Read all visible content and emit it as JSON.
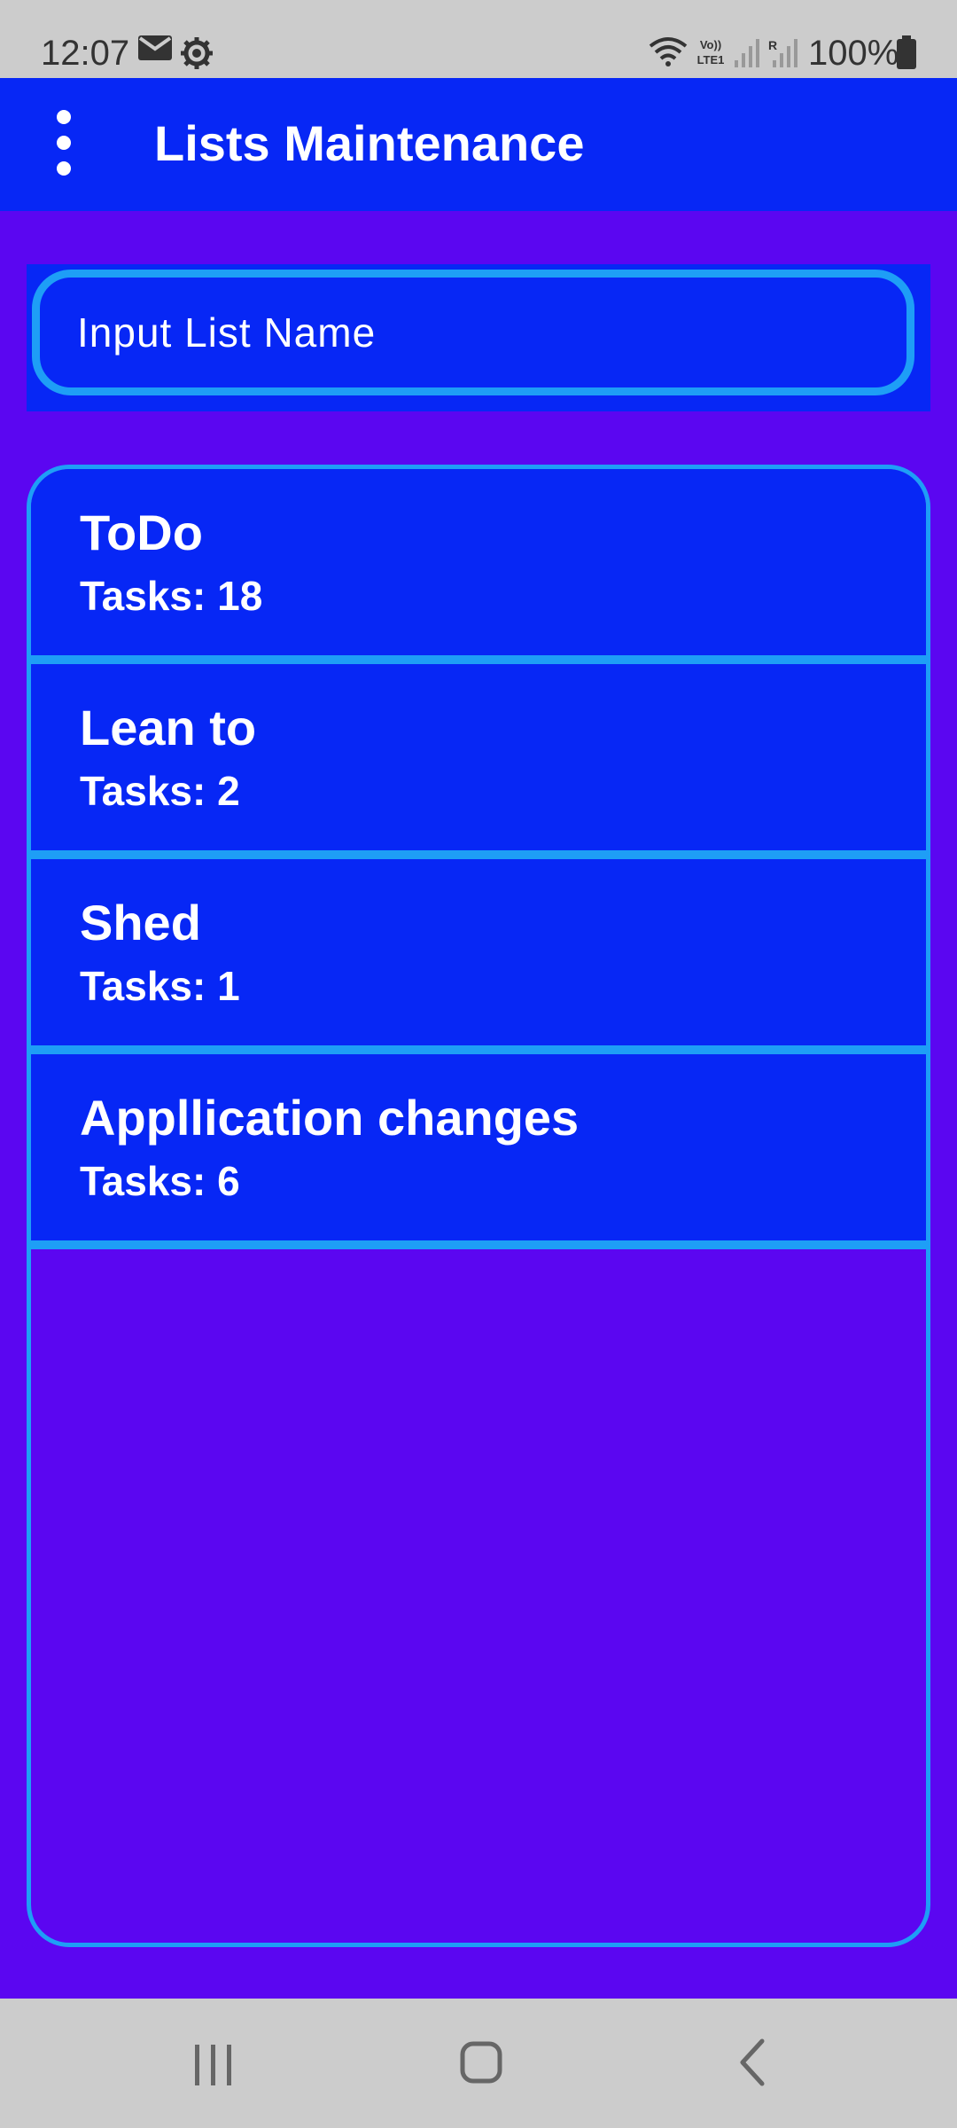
{
  "status_bar": {
    "time": "12:07",
    "battery_percent": "100%",
    "icons": [
      "email-icon",
      "settings-icon",
      "wifi-icon",
      "volte-icon",
      "signal-icon",
      "signal-roaming-icon",
      "battery-icon"
    ]
  },
  "app_bar": {
    "title": "Lists Maintenance",
    "menu_icon": "more-vertical-icon"
  },
  "input": {
    "placeholder": "Input List Name",
    "value": ""
  },
  "lists": [
    {
      "name": "ToDo",
      "tasks": "Tasks: 18"
    },
    {
      "name": "Lean to",
      "tasks": "Tasks: 2"
    },
    {
      "name": "Shed",
      "tasks": "Tasks: 1"
    },
    {
      "name": "Appllication changes",
      "tasks": "Tasks: 6"
    }
  ],
  "nav_bar": {
    "buttons": [
      "recent-apps-icon",
      "home-icon",
      "back-icon"
    ]
  },
  "colors": {
    "background": "#5b06f1",
    "app_bar": "#0727f5",
    "accent_border": "#1e9ef6",
    "system_bar": "#cccccc",
    "text": "#ffffff"
  }
}
